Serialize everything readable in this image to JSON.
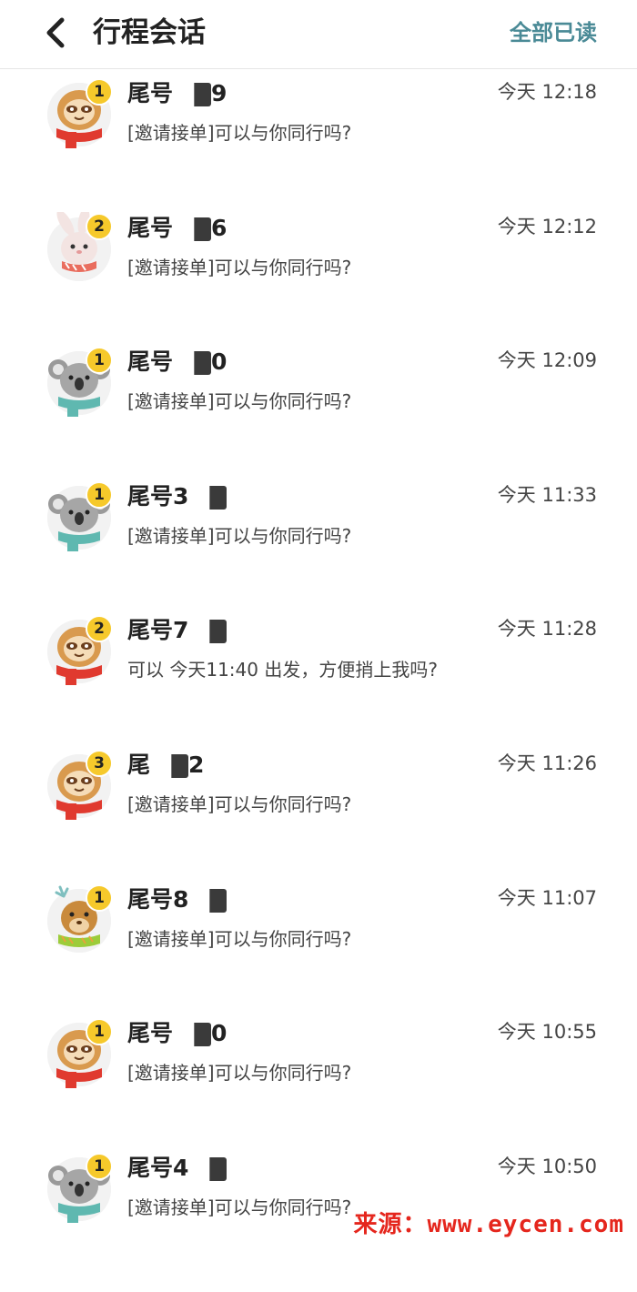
{
  "header": {
    "title": "行程会话",
    "mark_all_read": "全部已读"
  },
  "conversations": [
    {
      "avatar": "sloth-avatar",
      "badge": "1",
      "name": "尾号",
      "name_suffix": "9",
      "time": "今天 12:18",
      "message": "[邀请接单]可以与你同行吗?"
    },
    {
      "avatar": "rabbit-avatar",
      "badge": "2",
      "name": "尾号",
      "name_suffix": "6",
      "time": "今天 12:12",
      "message": "[邀请接单]可以与你同行吗?"
    },
    {
      "avatar": "koala-avatar",
      "badge": "1",
      "name": "尾号",
      "name_suffix": "0",
      "time": "今天 12:09",
      "message": "[邀请接单]可以与你同行吗?"
    },
    {
      "avatar": "koala-avatar",
      "badge": "1",
      "name": "尾号3",
      "name_suffix": "",
      "time": "今天 11:33",
      "message": "[邀请接单]可以与你同行吗?"
    },
    {
      "avatar": "sloth-avatar",
      "badge": "2",
      "name": "尾号7",
      "name_suffix": "",
      "time": "今天 11:28",
      "message": "可以 今天11:40 出发，方便捎上我吗?"
    },
    {
      "avatar": "sloth-avatar",
      "badge": "3",
      "name": "尾",
      "name_suffix": "2",
      "time": "今天 11:26",
      "message": "[邀请接单]可以与你同行吗?"
    },
    {
      "avatar": "deer-avatar",
      "badge": "1",
      "name": "尾号8",
      "name_suffix": "",
      "time": "今天 11:07",
      "message": "[邀请接单]可以与你同行吗?"
    },
    {
      "avatar": "sloth-avatar",
      "badge": "1",
      "name": "尾号",
      "name_suffix": "0",
      "time": "今天 10:55",
      "message": "[邀请接单]可以与你同行吗?"
    },
    {
      "avatar": "koala-avatar",
      "badge": "1",
      "name": "尾号4",
      "name_suffix": "",
      "time": "今天 10:50",
      "message": "[邀请接单]可以与你同行吗?"
    }
  ],
  "watermark": "来源：www.eycen.com"
}
